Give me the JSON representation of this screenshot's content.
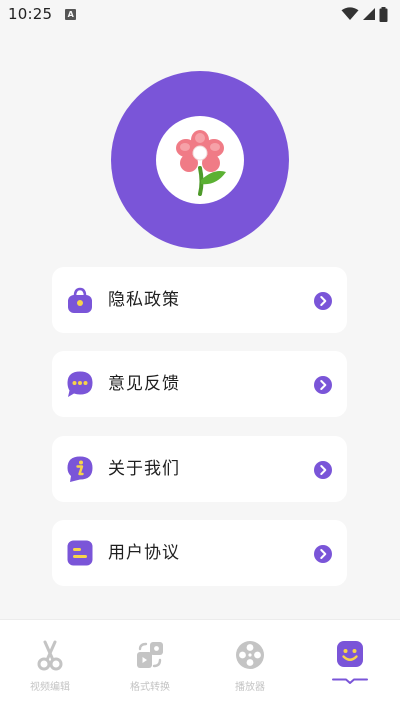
{
  "status_bar": {
    "time": "10:25",
    "indicator": "A",
    "icons": [
      "wifi-icon",
      "signal-icon",
      "battery-icon"
    ]
  },
  "hero": {
    "image": "pink-flower-icon",
    "ring_color": "#7a55d8"
  },
  "menu": {
    "items": [
      {
        "label": "隐私政策",
        "icon": "lock-bag-icon"
      },
      {
        "label": "意见反馈",
        "icon": "chat-bubble-icon"
      },
      {
        "label": "关于我们",
        "icon": "info-icon"
      },
      {
        "label": "用户协议",
        "icon": "document-lines-icon"
      }
    ],
    "accent_color": "#7a55d8",
    "icon_highlight_color": "#f7d44a"
  },
  "tabs": {
    "items": [
      {
        "label": "视频编辑",
        "icon": "scissors-icon",
        "active": false
      },
      {
        "label": "格式转换",
        "icon": "convert-icon",
        "active": false
      },
      {
        "label": "播放器",
        "icon": "film-reel-icon",
        "active": false
      },
      {
        "label": "",
        "icon": "smiley-icon",
        "active": true
      }
    ],
    "inactive_color": "#c4c4c4",
    "active_color": "#7a55d8"
  }
}
